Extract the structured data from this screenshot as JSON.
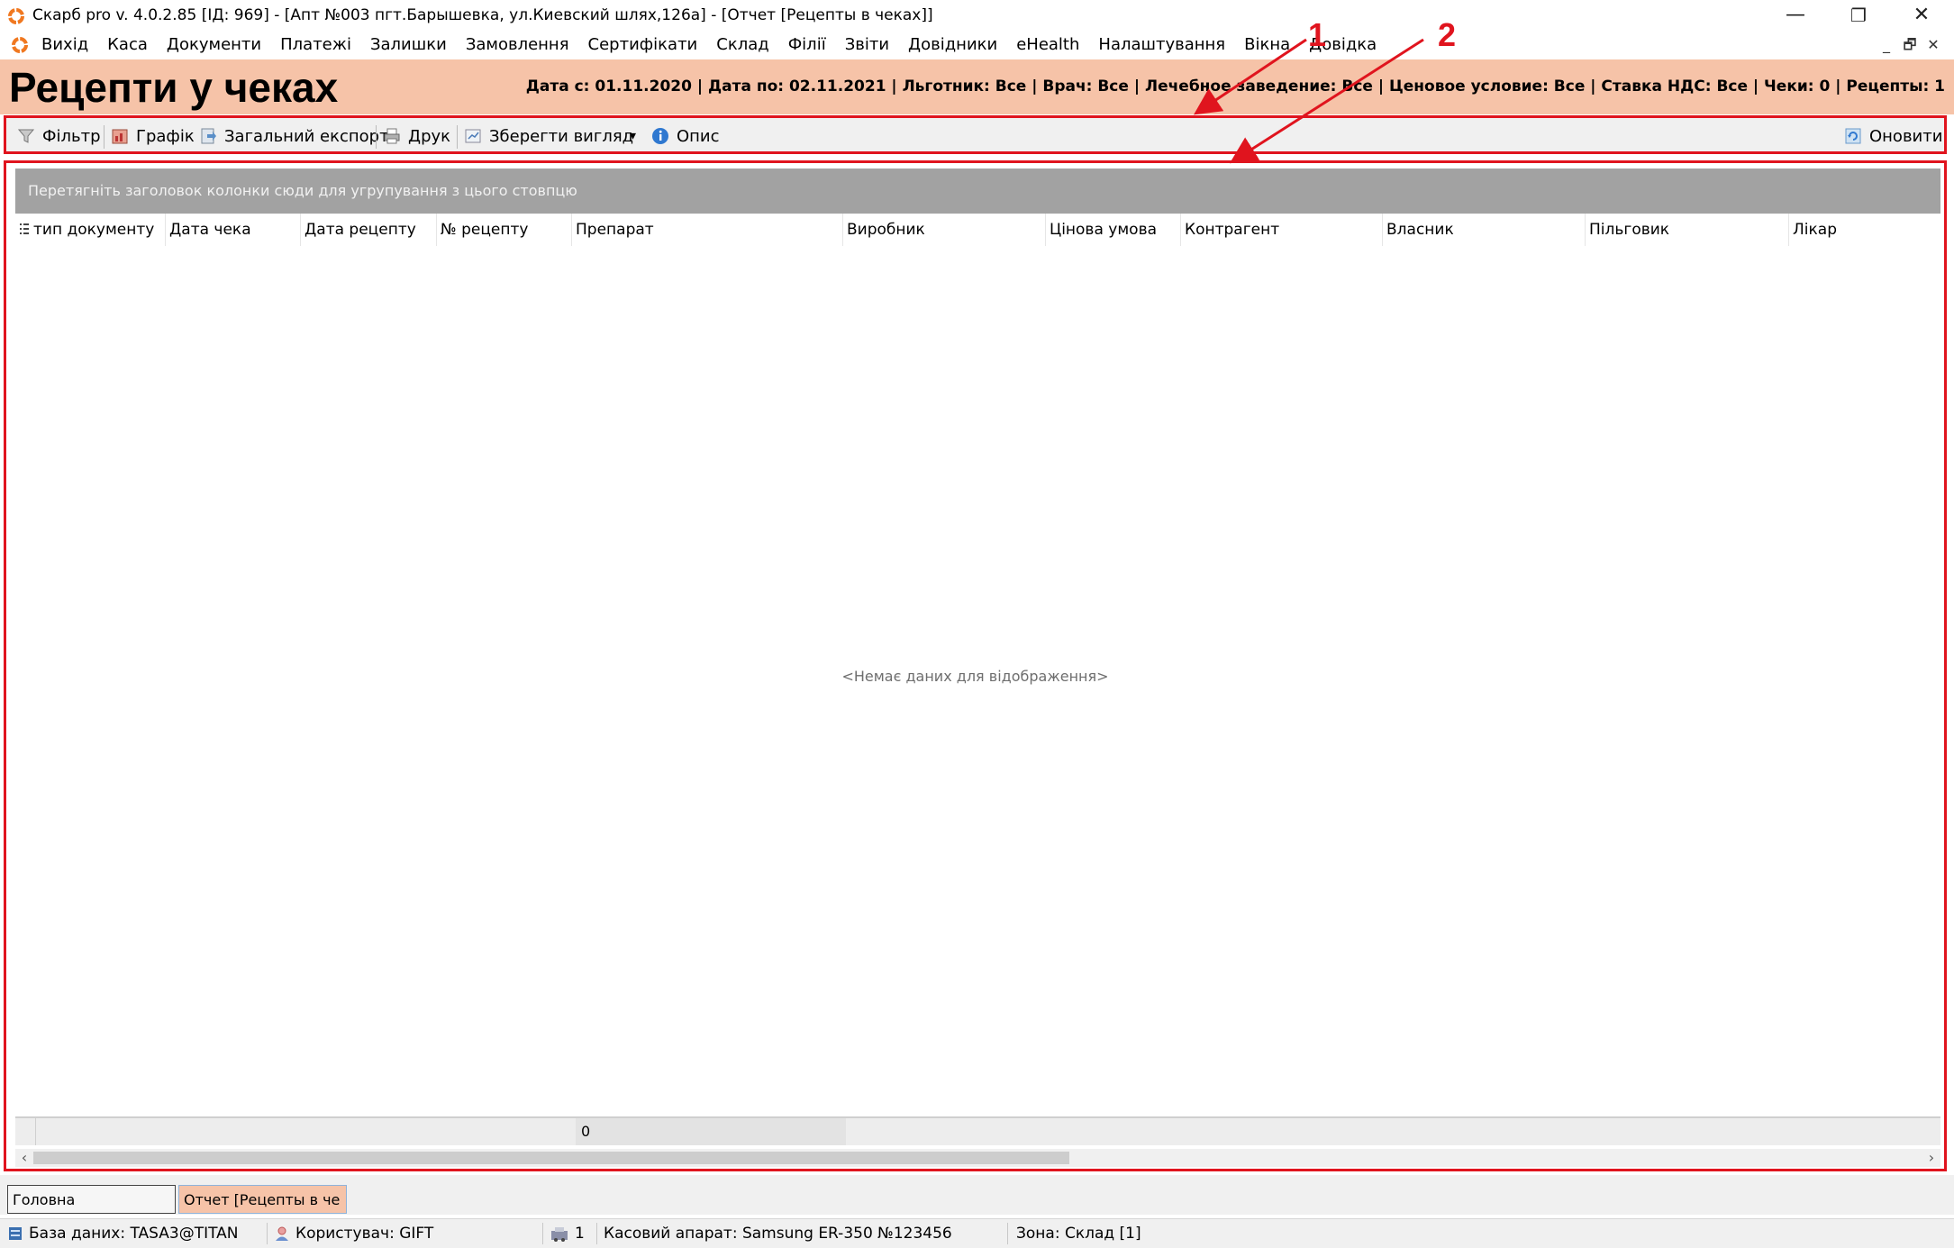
{
  "window": {
    "title": "Скарб pro v. 4.0.2.85 [ІД: 969] - [Апт №003 пгт.Барышевка, ул.Киевский шлях,126а] - [Отчет [Рецепты в чеках]]",
    "minimize": "—",
    "restore": "❐",
    "close": "✕"
  },
  "menu": {
    "items": [
      "Вихід",
      "Каса",
      "Документи",
      "Платежі",
      "Залишки",
      "Замовлення",
      "Сертифікати",
      "Склад",
      "Філії",
      "Звіти",
      "Довідники",
      "eHealth",
      "Налаштування",
      "Вікна",
      "Довідка"
    ],
    "mdi_minimize": "_",
    "mdi_restore": "🗗",
    "mdi_close": "✕"
  },
  "report": {
    "title": "Рецепти у чеках",
    "filter_summary": "Дата с: 01.11.2020 | Дата по: 02.11.2021 | Льготник: Все | Врач: Все | Лечебное заведение: Все | Ценовое условие: Все | Ставка НДС: Все | Чеки: 0 | Рецепты: 1"
  },
  "toolbar": {
    "filter_label": "Фільтр",
    "chart_label": "Графік",
    "export_label": "Загальний експорт",
    "print_label": "Друк",
    "save_view_label": "Зберегти вигляд",
    "dropdown_arrow": "▾",
    "description_label": "Опис",
    "refresh_label": "Оновити"
  },
  "grid": {
    "group_panel_text": "Перетягніть заголовок колонки сюди для угрупування з цього стовпцю",
    "columns": [
      "тип документу",
      "Дата чека",
      "Дата рецепту",
      "№ рецепту",
      "Препарат",
      "Виробник",
      "Цінова умова",
      "Контрагент",
      "Власник",
      "Пільговик",
      "Лікар"
    ],
    "empty_text": "<Немає даних для відображення>",
    "footer_value": "0",
    "scroll_left": "‹",
    "scroll_right": "›"
  },
  "annotations": [
    "1",
    "2"
  ],
  "tabs": [
    {
      "label": "Головна"
    },
    {
      "label": "Отчет [Рецепты в че ..."
    }
  ],
  "status": {
    "database": "База даних: TASA3@TITAN",
    "user": "Користувач: GIFT",
    "count": "1",
    "cash_register": "Касовий апарат: Samsung ER-350 №123456",
    "zone": "Зона: Склад [1]"
  },
  "colors": {
    "accent_orange": "#f6c3a8",
    "annotation_red": "#e0141e",
    "group_panel": "#a2a2a2"
  }
}
